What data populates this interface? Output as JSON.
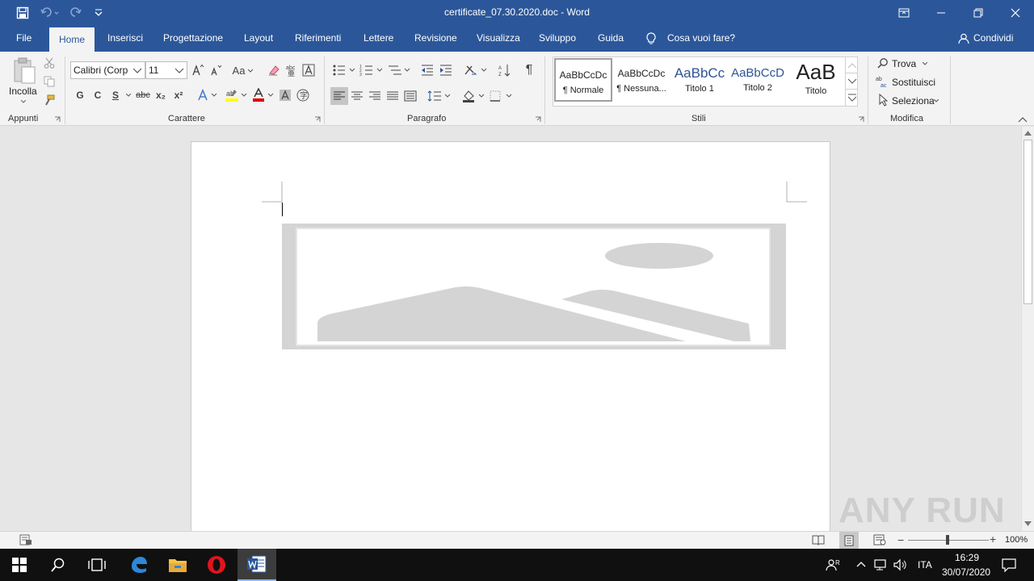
{
  "window": {
    "title": "certificate_07.30.2020.doc  -  Word"
  },
  "tabs": [
    {
      "label": "File"
    },
    {
      "label": "Home"
    },
    {
      "label": "Inserisci"
    },
    {
      "label": "Progettazione"
    },
    {
      "label": "Layout"
    },
    {
      "label": "Riferimenti"
    },
    {
      "label": "Lettere"
    },
    {
      "label": "Revisione"
    },
    {
      "label": "Visualizza"
    },
    {
      "label": "Sviluppo"
    },
    {
      "label": "Guida"
    }
  ],
  "tell_me": "Cosa vuoi fare?",
  "share": "Condividi",
  "ribbon": {
    "clipboard": {
      "paste": "Incolla",
      "label": "Appunti"
    },
    "font": {
      "name": "Calibri (Corp",
      "size": "11",
      "change_case": "Aa",
      "bold": "G",
      "italic": "C",
      "underline": "S",
      "strike": "abc",
      "subscript": "x₂",
      "superscript": "x²",
      "label": "Carattere",
      "highlight_color": "#ffff00",
      "font_color": "#e00000"
    },
    "paragraph": {
      "label": "Paragrafo"
    },
    "styles": {
      "label": "Stili",
      "items": [
        {
          "sample": "AaBbCcDc",
          "name": "¶ Normale"
        },
        {
          "sample": "AaBbCcDc",
          "name": "¶ Nessuna..."
        },
        {
          "sample": "AaBbCc",
          "name": "Titolo 1"
        },
        {
          "sample": "AaBbCcD",
          "name": "Titolo 2"
        },
        {
          "sample": "AaB",
          "name": "Titolo"
        }
      ]
    },
    "editing": {
      "label": "Modifica",
      "find": "Trova",
      "replace": "Sostituisci",
      "select": "Seleziona"
    }
  },
  "status": {
    "zoom": "100%"
  },
  "taskbar": {
    "time": "16:29",
    "date": "30/07/2020",
    "language": "ITA"
  },
  "watermark": "ANY RUN",
  "colors": {
    "word_blue": "#2b579a",
    "ribbon_bg": "#f3f3f3",
    "taskbar_bg": "#101010"
  }
}
